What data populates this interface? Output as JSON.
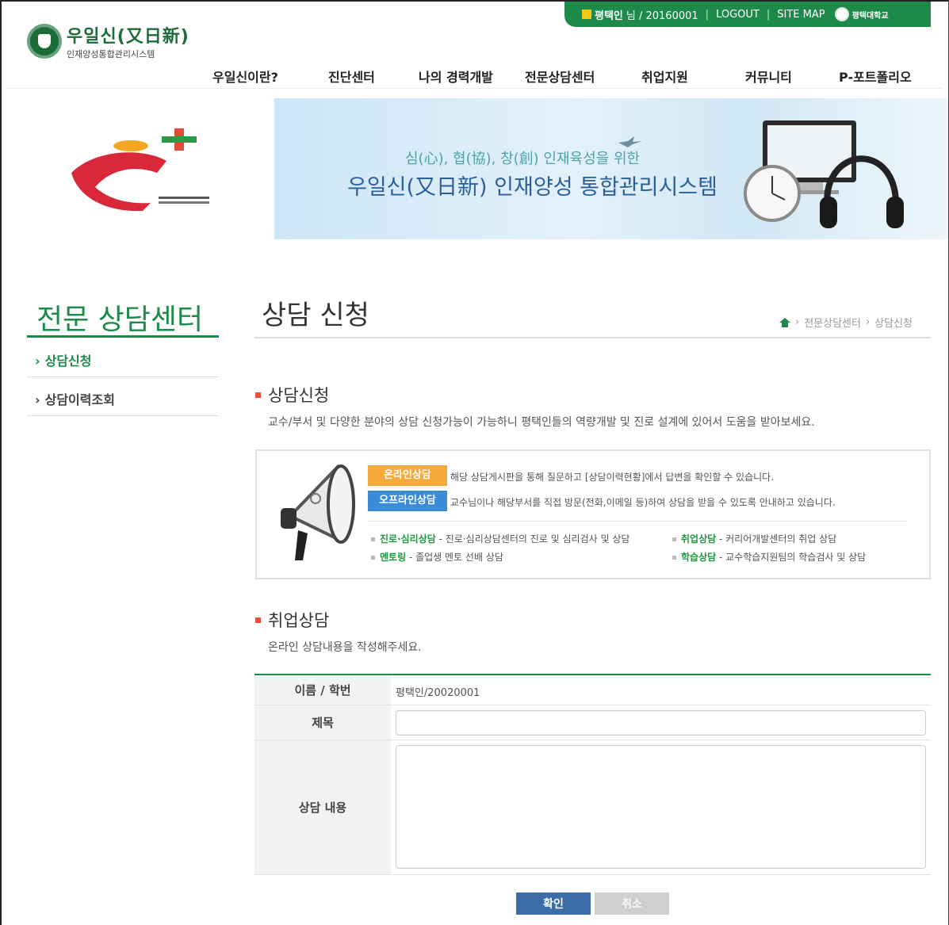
{
  "header": {
    "user_name": "평택인",
    "user_suffix": "님 / 20160001",
    "logout": "LOGOUT",
    "sitemap": "SITE MAP",
    "university": "평택대학교",
    "logo_title": "우일신(又日新)",
    "logo_sub": "인재양성통합관리시스템"
  },
  "nav": [
    "우일신이란?",
    "진단센터",
    "나의 경력개발",
    "전문상담센터",
    "취업지원",
    "커뮤니티",
    "P-포트폴리오"
  ],
  "banner": {
    "sub": "심(心), 협(協), 창(創) 인재육성을 위한",
    "title": "우일신(又日新) 인재양성 통합관리시스템"
  },
  "sidebar": {
    "title": "전문 상담센터",
    "items": [
      {
        "label": "상담신청"
      },
      {
        "label": "상담이력조회"
      }
    ]
  },
  "main": {
    "title": "상담 신청",
    "breadcrumb": [
      "전문상담센터",
      "상담신청"
    ],
    "section1_title": "상담신청",
    "section1_desc": "교수/부서 및 다양한 분야의 상담 신청가능이 가능하니 평택인들의 역량개발 및 진로 설계에 있어서 도움을 받아보세요.",
    "info": {
      "online_tag": "온라인상담",
      "online_desc": "해당 상담게시판을 통해 질문하고 [상담이력현황]에서 답변을 확인할 수 있습니다.",
      "offline_tag": "오프라인상담",
      "offline_desc": "교수님이나 해당부서를 직접 방문(전화,이메일 등)하여 상담을 받을 수 있도록 안내하고 있습니다.",
      "categories": [
        {
          "name": "진로·심리상담",
          "desc": " - 진로·심리상담센터의 진로 및 심리검사 및 상담"
        },
        {
          "name": "취업상담",
          "desc": " - 커리어개발센터의 취업 상담"
        },
        {
          "name": "멘토링",
          "desc": " - 졸업생 멘토 선배 상담"
        },
        {
          "name": "학습상담",
          "desc": " - 교수학습지원팀의 학습검사 및 상담"
        }
      ]
    },
    "section2_title": "취업상담",
    "section2_desc": "온라인 상담내용을 작성해주세요.",
    "form": {
      "name_label": "이름 / 학번",
      "name_value": "평택인/20020001",
      "subject_label": "제목",
      "subject_value": "",
      "content_label": "상담 내용",
      "content_value": ""
    },
    "buttons": {
      "ok": "확인",
      "cancel": "취소"
    }
  },
  "colors": {
    "brand_green": "#1e8a4a",
    "online_orange": "#f6a93b",
    "offline_blue": "#3a8bd8",
    "ok_button": "#3b6ea9"
  }
}
